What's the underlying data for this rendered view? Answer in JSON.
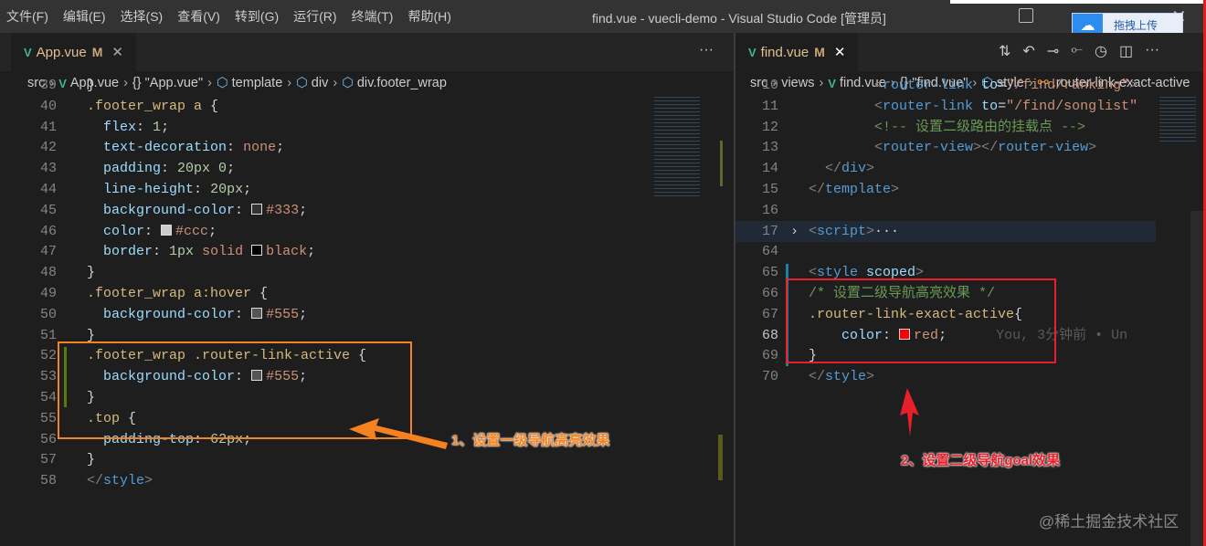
{
  "menu": [
    "文件(F)",
    "编辑(E)",
    "选择(S)",
    "查看(V)",
    "转到(G)",
    "运行(R)",
    "终端(T)",
    "帮助(H)"
  ],
  "window_title": "find.vue - vuecli-demo - Visual Studio Code [管理员]",
  "upload_widget": {
    "label": "拖拽上传",
    "icon": "cloud-upload-icon"
  },
  "left": {
    "tab": {
      "name": "App.vue",
      "badge": "M"
    },
    "breadcrumbs": [
      "src",
      "App.vue",
      "{} \"App.vue\"",
      "template",
      "div",
      "div.footer_wrap"
    ],
    "lines": [
      {
        "n": "39",
        "t": [
          [
            "pun",
            "}"
          ]
        ]
      },
      {
        "n": "40",
        "t": [
          [
            "sel",
            ".footer_wrap a"
          ],
          [
            "pun",
            " {"
          ]
        ]
      },
      {
        "n": "41",
        "t": [
          [
            "pun",
            "  "
          ],
          [
            "prop",
            "flex"
          ],
          [
            "pun",
            ": "
          ],
          [
            "num",
            "1"
          ],
          [
            "pun",
            ";"
          ]
        ]
      },
      {
        "n": "42",
        "t": [
          [
            "pun",
            "  "
          ],
          [
            "prop",
            "text-decoration"
          ],
          [
            "pun",
            ": "
          ],
          [
            "val",
            "none"
          ],
          [
            "pun",
            ";"
          ]
        ]
      },
      {
        "n": "43",
        "t": [
          [
            "pun",
            "  "
          ],
          [
            "prop",
            "padding"
          ],
          [
            "pun",
            ": "
          ],
          [
            "num",
            "20px 0"
          ],
          [
            "pun",
            ";"
          ]
        ]
      },
      {
        "n": "44",
        "t": [
          [
            "pun",
            "  "
          ],
          [
            "prop",
            "line-height"
          ],
          [
            "pun",
            ": "
          ],
          [
            "num",
            "20px"
          ],
          [
            "pun",
            ";"
          ]
        ]
      },
      {
        "n": "45",
        "t": [
          [
            "pun",
            "  "
          ],
          [
            "prop",
            "background-color"
          ],
          [
            "pun",
            ": "
          ],
          [
            "sw",
            "#333333"
          ],
          [
            "val",
            "#333"
          ],
          [
            "pun",
            ";"
          ]
        ]
      },
      {
        "n": "46",
        "t": [
          [
            "pun",
            "  "
          ],
          [
            "prop",
            "color"
          ],
          [
            "pun",
            ": "
          ],
          [
            "sw",
            "#cccccc"
          ],
          [
            "val",
            "#ccc"
          ],
          [
            "pun",
            ";"
          ]
        ]
      },
      {
        "n": "47",
        "t": [
          [
            "pun",
            "  "
          ],
          [
            "prop",
            "border"
          ],
          [
            "pun",
            ": "
          ],
          [
            "num",
            "1px"
          ],
          [
            "val",
            " solid "
          ],
          [
            "sw",
            "#000000"
          ],
          [
            "val",
            "black"
          ],
          [
            "pun",
            ";"
          ]
        ]
      },
      {
        "n": "48",
        "t": [
          [
            "pun",
            "}"
          ]
        ]
      },
      {
        "n": "49",
        "t": [
          [
            "sel",
            ".footer_wrap a:hover"
          ],
          [
            "pun",
            " {"
          ]
        ]
      },
      {
        "n": "50",
        "t": [
          [
            "pun",
            "  "
          ],
          [
            "prop",
            "background-color"
          ],
          [
            "pun",
            ": "
          ],
          [
            "sw",
            "#555555"
          ],
          [
            "val",
            "#555"
          ],
          [
            "pun",
            ";"
          ]
        ]
      },
      {
        "n": "51",
        "t": [
          [
            "pun",
            "}"
          ]
        ]
      },
      {
        "n": "52",
        "t": [
          [
            "sel",
            ".footer_wrap .router-link-active"
          ],
          [
            "pun",
            " {"
          ]
        ]
      },
      {
        "n": "53",
        "t": [
          [
            "pun",
            "  "
          ],
          [
            "prop",
            "background-color"
          ],
          [
            "pun",
            ": "
          ],
          [
            "sw",
            "#555555"
          ],
          [
            "val",
            "#555"
          ],
          [
            "pun",
            ";"
          ]
        ]
      },
      {
        "n": "54",
        "t": [
          [
            "pun",
            "}"
          ]
        ]
      },
      {
        "n": "55",
        "t": [
          [
            "sel",
            ".top"
          ],
          [
            "pun",
            " {"
          ]
        ]
      },
      {
        "n": "56",
        "t": [
          [
            "pun",
            "  "
          ],
          [
            "prop",
            "padding-top"
          ],
          [
            "pun",
            ": "
          ],
          [
            "num",
            "62px"
          ],
          [
            "pun",
            ";"
          ]
        ]
      },
      {
        "n": "57",
        "t": [
          [
            "pun",
            "}"
          ]
        ]
      },
      {
        "n": "58",
        "t": [
          [
            "tagb",
            "</"
          ],
          [
            "tag",
            "style"
          ],
          [
            "tagb",
            ">"
          ]
        ]
      }
    ]
  },
  "right": {
    "tab": {
      "name": "find.vue",
      "badge": "M"
    },
    "breadcrumbs": [
      "src",
      "views",
      "find.vue",
      "{} \"find.vue\"",
      "style",
      ".router-link-exact-active"
    ],
    "toolbar_icons": [
      "compare-changes-icon",
      "go-back-icon",
      "previous-change-icon",
      "next-change-icon",
      "git-timeline-icon",
      "split-editor-icon",
      "more-actions-icon"
    ],
    "lines": [
      {
        "n": "10",
        "t": [
          [
            "pun",
            "        "
          ],
          [
            "tagb",
            "<"
          ],
          [
            "tag",
            "router-link"
          ],
          [
            "attr",
            " to"
          ],
          [
            "pun",
            "="
          ],
          [
            "str",
            "\"/find/ranking\""
          ],
          [
            "tagb",
            ">"
          ]
        ]
      },
      {
        "n": "11",
        "t": [
          [
            "pun",
            "        "
          ],
          [
            "tagb",
            "<"
          ],
          [
            "tag",
            "router-link"
          ],
          [
            "attr",
            " to"
          ],
          [
            "pun",
            "="
          ],
          [
            "str",
            "\"/find/songlist\""
          ]
        ]
      },
      {
        "n": "12",
        "t": [
          [
            "pun",
            "        "
          ],
          [
            "com",
            "<!-- 设置二级路由的挂载点 -->"
          ]
        ]
      },
      {
        "n": "13",
        "t": [
          [
            "pun",
            "        "
          ],
          [
            "tagb",
            "<"
          ],
          [
            "tag",
            "router-view"
          ],
          [
            "tagb",
            "></"
          ],
          [
            "tag",
            "router-view"
          ],
          [
            "tagb",
            ">"
          ]
        ]
      },
      {
        "n": "14",
        "t": [
          [
            "pun",
            "  "
          ],
          [
            "tagb",
            "</"
          ],
          [
            "tag",
            "div"
          ],
          [
            "tagb",
            ">"
          ]
        ]
      },
      {
        "n": "15",
        "t": [
          [
            "tagb",
            "</"
          ],
          [
            "tag",
            "template"
          ],
          [
            "tagb",
            ">"
          ]
        ]
      },
      {
        "n": "16",
        "t": []
      },
      {
        "n": "17",
        "t": [
          [
            "tagb",
            "<"
          ],
          [
            "tag",
            "script"
          ],
          [
            "tagb",
            ">"
          ],
          [
            "pun",
            "···"
          ]
        ],
        "folded": true
      },
      {
        "n": "64",
        "t": []
      },
      {
        "n": "65",
        "t": [
          [
            "tagb",
            "<"
          ],
          [
            "tag",
            "style"
          ],
          [
            "attr",
            " scoped"
          ],
          [
            "tagb",
            ">"
          ]
        ]
      },
      {
        "n": "66",
        "t": [
          [
            "com",
            "/* 设置二级导航高亮效果 */"
          ]
        ]
      },
      {
        "n": "67",
        "t": [
          [
            "sel",
            ".router-link-exact-active"
          ],
          [
            "pun",
            "{"
          ]
        ]
      },
      {
        "n": "68",
        "t": [
          [
            "pun",
            "    "
          ],
          [
            "prop",
            "color"
          ],
          [
            "pun",
            ": "
          ],
          [
            "sw",
            "#ff0000"
          ],
          [
            "val",
            "red"
          ],
          [
            "pun",
            ";"
          ],
          [
            "blame",
            "      You, 3分钟前 • Un"
          ]
        ],
        "current": true
      },
      {
        "n": "69",
        "t": [
          [
            "pun",
            "}"
          ]
        ]
      },
      {
        "n": "70",
        "t": [
          [
            "tagb",
            "</"
          ],
          [
            "tag",
            "style"
          ],
          [
            "tagb",
            ">"
          ]
        ]
      }
    ]
  },
  "annotations": {
    "first": {
      "text": "1、设置一级导航高亮效果",
      "color": "#f5821f"
    },
    "second": {
      "text": "2、设置二级导航goal效果",
      "color": "#e8202a"
    }
  },
  "watermark": "@稀土掘金技术社区"
}
